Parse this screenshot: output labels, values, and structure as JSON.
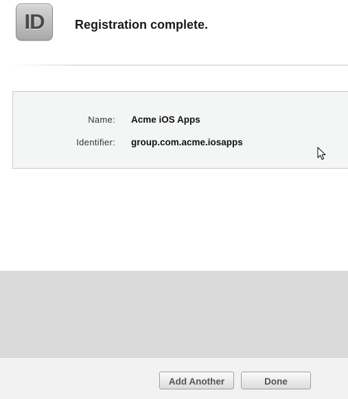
{
  "header": {
    "icon_text": "ID",
    "title": "Registration complete."
  },
  "details": {
    "name_label": "Name:",
    "name_value": "Acme iOS Apps",
    "identifier_label": "Identifier:",
    "identifier_value": "group.com.acme.iosapps"
  },
  "footer": {
    "add_another_label": "Add Another",
    "done_label": "Done"
  },
  "icons": {
    "app_icon": "id-badge-icon",
    "pointer": "mouse-cursor-icon"
  },
  "colors": {
    "details_background": "#f4f6f5",
    "gray_area": "#dadada",
    "footer_background": "#f2f2f2"
  }
}
